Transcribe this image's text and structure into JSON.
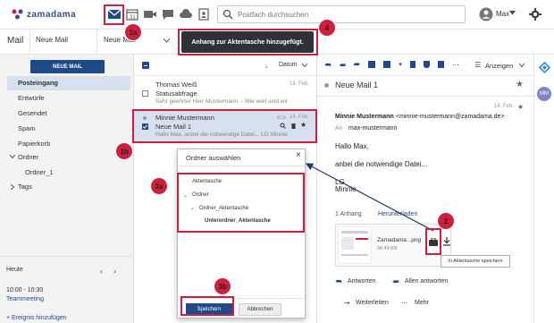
{
  "brand": {
    "name": "zamadama"
  },
  "header": {
    "search_placeholder": "Postfach durchsuchen",
    "user_name": "Max",
    "icons": [
      "mail-icon",
      "calendar-icon",
      "video-icon",
      "chat-icon",
      "cloud-icon",
      "contacts-icon",
      "search-icon",
      "avatar-icon",
      "gear-icon"
    ]
  },
  "toolbar2": {
    "section_title": "Mail",
    "new_mail_1": "Neue Mail",
    "new_mail_2": "Neue Mail"
  },
  "toast": {
    "text": "Anhang zur Aktentasche hinzugefügt."
  },
  "sidebar": {
    "new_mail_button": "NEUE MAIL",
    "folders": [
      {
        "label": "Posteingang"
      },
      {
        "label": "Entwürfe"
      },
      {
        "label": "Gesendet"
      },
      {
        "label": "Spam"
      },
      {
        "label": "Papierkorb"
      },
      {
        "label": "Ordner"
      },
      {
        "label": "Ordner_1"
      },
      {
        "label": "Tags"
      }
    ],
    "calendar": {
      "day_label": "Heute",
      "time": "10:00 - 10:30",
      "event": "Teammeeting",
      "add_event": "+ Ereignis hinzufügen"
    }
  },
  "list": {
    "sort_label": "Datum",
    "mails": [
      {
        "from": "Thomas Weiß",
        "date": "18. Feb.",
        "subject": "Statusabfrage",
        "preview": "Sehr geehrter Herr Mustermann.   - Wie weit sind wir"
      },
      {
        "from": "Minnie Mustermann",
        "date": "14. Feb.",
        "subject": "Neue Mail 1",
        "preview": "Hallo Max,    anbei die notwendige Datei...   LG Minnie"
      }
    ]
  },
  "reader": {
    "toolbar_view_label": "Anzeigen",
    "subject": "Neue Mail 1",
    "date": "14. Feb.",
    "sender_name": "Minnie Mustermann",
    "sender_email": "<minnie-mustermann@zamadama.de>",
    "to_label": "An",
    "to": "max-mustermann",
    "body_lines": [
      "Hallo Max,",
      "anbei die notwendige Datei...",
      "LG",
      "Minnie"
    ],
    "attachment_count": "1 Anhang",
    "download_label": "Herunterladen",
    "attachment_name": "Zamadama...png",
    "attachment_size": "98.49 KB",
    "tooltip": "In Aktentasche speichern",
    "reply": "Antworten",
    "reply_all": "Allen antworten",
    "forward": "Weiterleiten",
    "more": "Mehr"
  },
  "dialog": {
    "title": "Ordner auswählen",
    "items": [
      {
        "label": "Aktentasche"
      },
      {
        "label": "Ordner"
      },
      {
        "label": "Ordner_Aktentasche"
      },
      {
        "label": "Unterordner_Aktentasche"
      }
    ],
    "save": "Speichern",
    "cancel": "Abbrechen"
  },
  "rail": {
    "avatar_initials": "MM"
  },
  "annotations": {
    "b1a": "1a",
    "b1b": "1b",
    "b2": "2",
    "b3a": "3a",
    "b3b": "3b",
    "b4": "4"
  },
  "colors": {
    "accent": "#1f4a8a",
    "annotation": "#d01f3c",
    "selection": "#d6e0ee"
  }
}
